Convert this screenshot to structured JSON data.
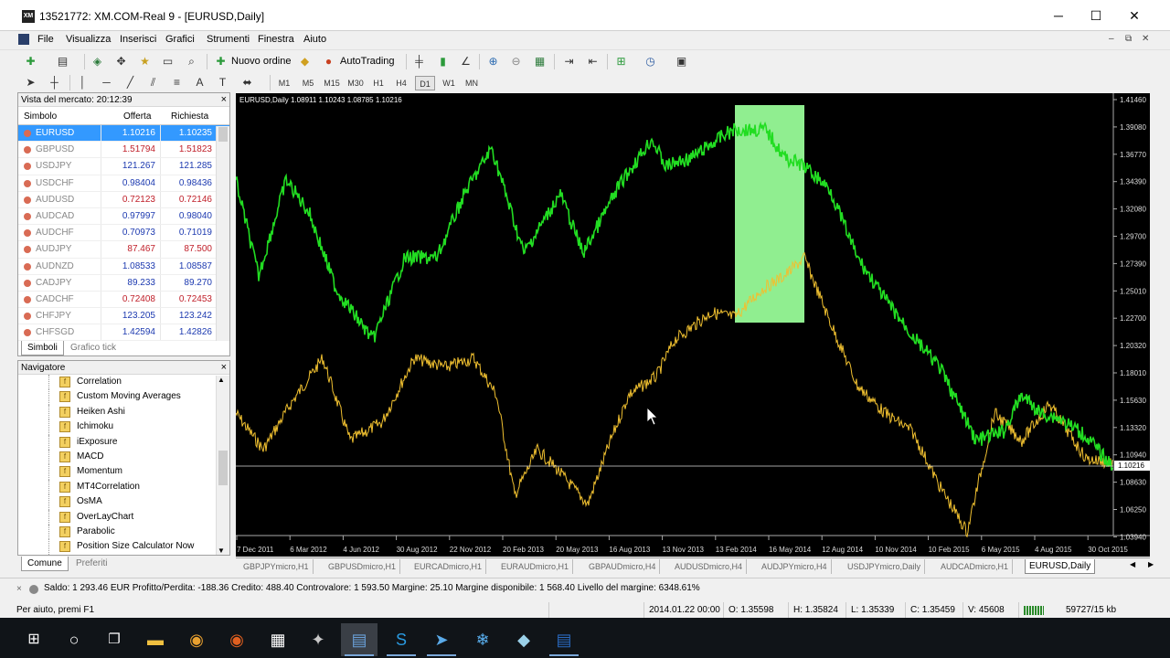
{
  "window": {
    "title": "13521772: XM.COM-Real 9 - [EURUSD,Daily]",
    "app_icon": "XM",
    "controls": [
      "─",
      "☐",
      "✕"
    ]
  },
  "menu": {
    "items": [
      "File",
      "Visualizza",
      "Inserisci",
      "Grafici",
      "Strumenti",
      "Finestra",
      "Aiuto"
    ],
    "mdi_controls": [
      "–",
      "⧉",
      "✕"
    ]
  },
  "toolbar": {
    "new_order_label": "Nuovo ordine",
    "autotrading_label": "AutoTrading",
    "timeframes": [
      "M1",
      "M5",
      "M15",
      "M30",
      "H1",
      "H4",
      "D1",
      "W1",
      "MN"
    ],
    "active_timeframe": "D1",
    "search_placeholder": ""
  },
  "market_watch": {
    "header": "Vista del mercato: 20:12:39",
    "columns": {
      "symbol": "Simbolo",
      "bid": "Offerta",
      "ask": "Richiesta"
    },
    "rows": [
      {
        "symbol": "EURUSD",
        "bid": "1.10216",
        "ask": "1.10235"
      },
      {
        "symbol": "GBPUSD",
        "bid": "1.51794",
        "ask": "1.51823"
      },
      {
        "symbol": "USDJPY",
        "bid": "121.267",
        "ask": "121.285"
      },
      {
        "symbol": "USDCHF",
        "bid": "0.98404",
        "ask": "0.98436"
      },
      {
        "symbol": "AUDUSD",
        "bid": "0.72123",
        "ask": "0.72146"
      },
      {
        "symbol": "AUDCAD",
        "bid": "0.97997",
        "ask": "0.98040"
      },
      {
        "symbol": "AUDCHF",
        "bid": "0.70973",
        "ask": "0.71019"
      },
      {
        "symbol": "AUDJPY",
        "bid": "87.467",
        "ask": "87.500"
      },
      {
        "symbol": "AUDNZD",
        "bid": "1.08533",
        "ask": "1.08587"
      },
      {
        "symbol": "CADJPY",
        "bid": "89.233",
        "ask": "89.270"
      },
      {
        "symbol": "CADCHF",
        "bid": "0.72408",
        "ask": "0.72453"
      },
      {
        "symbol": "CHFJPY",
        "bid": "123.205",
        "ask": "123.242"
      },
      {
        "symbol": "CHFSGD",
        "bid": "1.42594",
        "ask": "1.42826"
      }
    ],
    "tabs": [
      "Simboli",
      "Grafico tick"
    ]
  },
  "navigator": {
    "header": "Navigatore",
    "items": [
      "Correlation",
      "Custom Moving Averages",
      "Heiken Ashi",
      "Ichimoku",
      "iExposure",
      "MACD",
      "Momentum",
      "MT4Correlation",
      "OsMA",
      "OverLayChart",
      "Parabolic",
      "Position Size Calculator Now"
    ],
    "tabs": [
      "Comune",
      "Preferiti"
    ]
  },
  "chart": {
    "header": "EURUSD,Daily  1.08911 1.10243 1.08785 1.10216",
    "price_labels": [
      "1.41460",
      "1.39080",
      "1.36770",
      "1.34390",
      "1.32080",
      "1.29700",
      "1.27390",
      "1.25010",
      "1.22700",
      "1.20320",
      "1.18010",
      "1.15630",
      "1.13320",
      "1.10940",
      "1.08630",
      "1.06250",
      "1.03940"
    ],
    "current_price": "1.10216",
    "date_labels": [
      "7 Dec 2011",
      "6 Mar 2012",
      "4 Jun 2012",
      "30 Aug 2012",
      "22 Nov 2012",
      "20 Feb 2013",
      "20 May 2013",
      "16 Aug 2013",
      "13 Nov 2013",
      "13 Feb 2014",
      "16 May 2014",
      "12 Aug 2014",
      "10 Nov 2014",
      "10 Feb 2015",
      "6 May 2015",
      "4 Aug 2015",
      "30 Oct 2015"
    ],
    "colors": {
      "main_series": "#22dd22",
      "overlay_series": "#f0c030",
      "highlight": "#90ee90"
    }
  },
  "chart_tabs": [
    "GBPJPYmicro,H1",
    "GBPUSDmicro,H1",
    "EURCADmicro,H1",
    "EURAUDmicro,H1",
    "GBPAUDmicro,H4",
    "AUDUSDmicro,H4",
    "AUDJPYmicro,H4",
    "USDJPYmicro,Daily",
    "AUDCADmicro,H1",
    "EURUSD,Daily"
  ],
  "account": {
    "text": "Saldo: 1 293.46 EUR  Profitto/Perdita: -188.36  Credito: 488.40  Controvalore: 1 593.50  Margine: 25.10  Margine disponibile: 1 568.40  Livello del margine: 6348.61%"
  },
  "status": {
    "help": "Per aiuto, premi F1",
    "date": "2014.01.22 00:00",
    "open": "O: 1.35598",
    "high": "H: 1.35824",
    "low": "L: 1.35339",
    "close": "C: 1.35459",
    "volume": "V: 45608",
    "traffic": "59727/15 kb"
  },
  "taskbar": {
    "icons": [
      "windows-start-icon",
      "search-circle-icon",
      "task-view-icon",
      "file-explorer-icon",
      "chrome-icon",
      "firefox-icon",
      "calculator-icon",
      "app-icon",
      "metatrader-icon",
      "skype-icon",
      "telegram-icon",
      "snowflake-icon",
      "app2-icon",
      "document-icon"
    ]
  }
}
